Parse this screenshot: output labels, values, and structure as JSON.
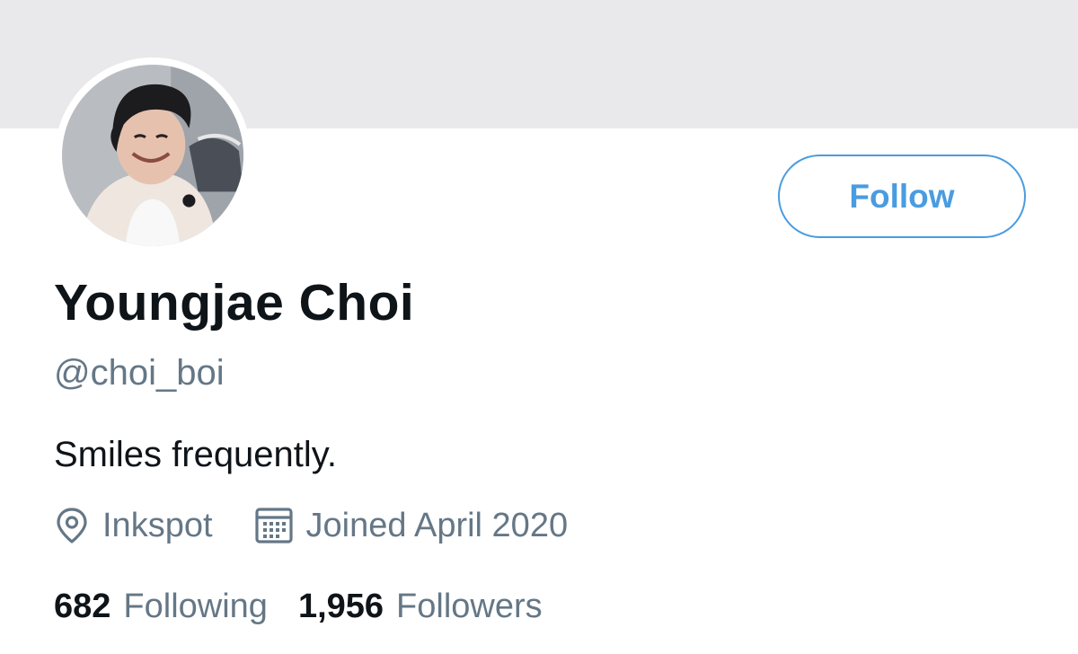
{
  "profile": {
    "display_name": "Youngjae Choi",
    "handle": "@choi_boi",
    "bio": "Smiles frequently.",
    "location": "Inkspot",
    "joined": "Joined April 2020"
  },
  "actions": {
    "follow_label": "Follow"
  },
  "stats": {
    "following_count": "682",
    "following_label": "Following",
    "followers_count": "1,956",
    "followers_label": "Followers"
  },
  "icons": {
    "location": "location-pin-icon",
    "joined": "calendar-icon"
  },
  "colors": {
    "banner": "#e9e9eb",
    "accent": "#4a9ce0",
    "secondary_text": "#657786",
    "primary_text": "#0f1419"
  }
}
